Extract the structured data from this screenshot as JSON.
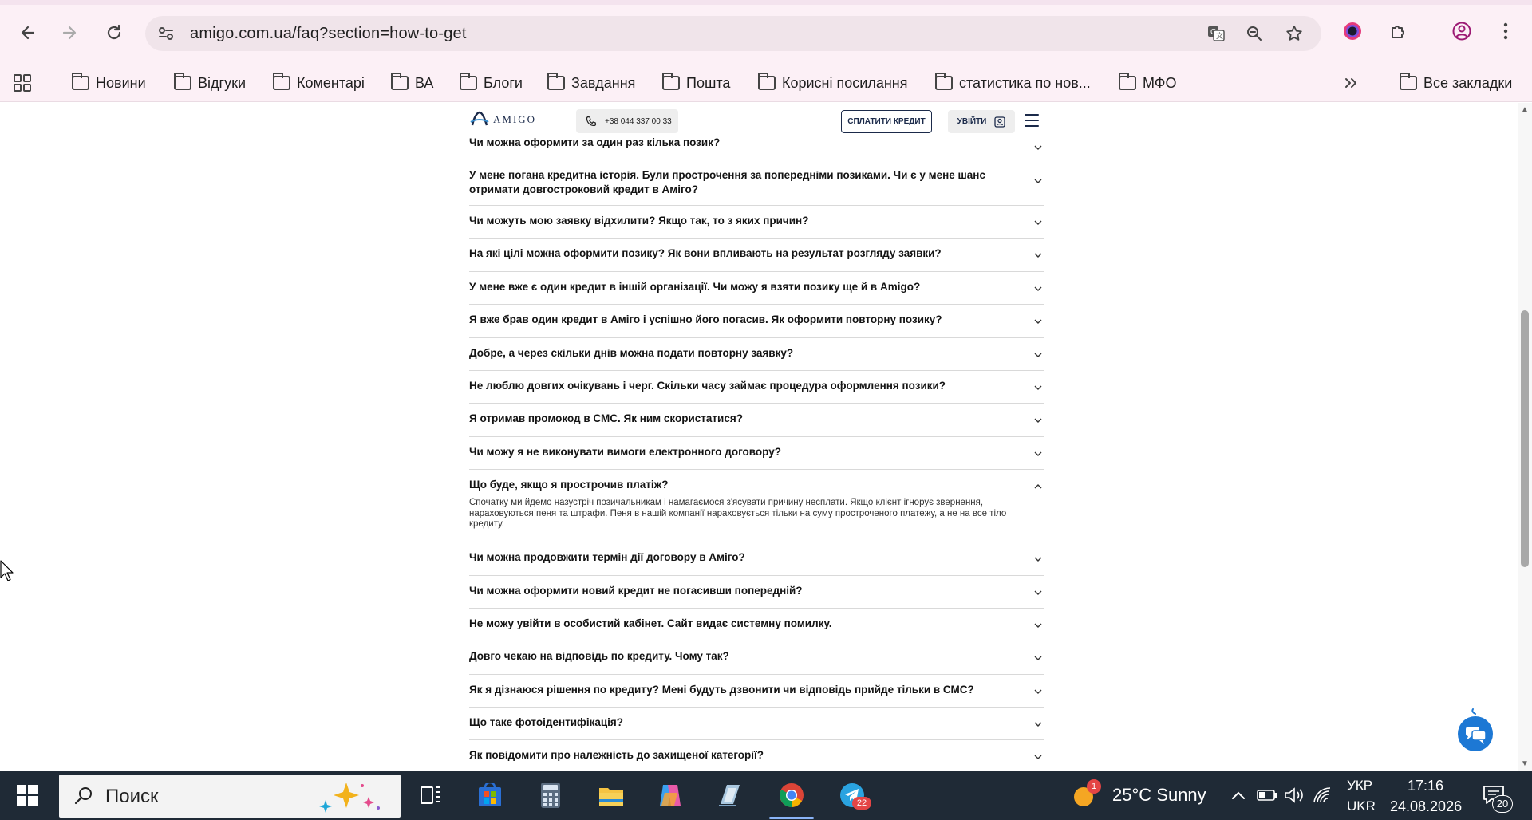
{
  "browser": {
    "url": "amigo.com.ua/faq?section=how-to-get",
    "bookmarks": [
      "Новини",
      "Відгуки",
      "Коментарі",
      "ВА",
      "Блоги",
      "Завдання",
      "Пошта",
      "Корисні посилання",
      "статистика по нов...",
      "МФО"
    ],
    "all_bookmarks": "Все закладки"
  },
  "site": {
    "logo": "AMIGO",
    "phone": "+38 044 337 00 33",
    "pay_button": "СПЛАТИТИ КРЕДИТ",
    "login_button": "УВІЙТИ"
  },
  "faq": {
    "items": [
      {
        "q": "Чи можна оформити за один раз кілька позик?"
      },
      {
        "q": "У мене погана кредитна історія. Були прострочення за попередніми позиками. Чи є у мене шанс отримати довгостроковий кредит в Аміго?"
      },
      {
        "q": "Чи можуть мою заявку відхилити? Якщо так, то з яких причин?"
      },
      {
        "q": "На які цілі можна оформити позику? Як вони впливають на результат розгляду заявки?"
      },
      {
        "q": "У мене вже є один кредит в іншій організації. Чи можу я взяти позику ще й в Amigo?"
      },
      {
        "q": "Я вже брав один кредит в Аміго і успішно його погасив. Як оформити повторну позику?"
      },
      {
        "q": "Добре, а через скільки днів можна подати повторну заявку?"
      },
      {
        "q": "Не люблю довгих очікувань і черг. Скільки часу займає процедура оформлення позики?"
      },
      {
        "q": "Я отримав промокод в СМС. Як ним скористатися?"
      },
      {
        "q": "Чи можу я не виконувати вимоги електронного договору?"
      },
      {
        "q": "Що буде, якщо я прострочив платіж?",
        "a": "Спочатку ми йдемо назустріч позичальникам і намагаємося з'ясувати причину несплати. Якщо клієнт ігнорує звернення, нараховуються пеня та штрафи. Пеня в нашій компанії нараховується тільки на суму простроченого платежу, а не на все тіло кредиту."
      },
      {
        "q": "Чи можна продовжити термін дії договору в Аміго?"
      },
      {
        "q": "Чи можна оформити новий кредит не погасивши попередній?"
      },
      {
        "q": "Не можу увійти в особистий кабінет. Сайт видає системну помилку."
      },
      {
        "q": "Довго чекаю на відповідь по кредиту. Чому так?"
      },
      {
        "q": "Як я дізнаюся рішення по кредиту? Мені будуть дзвонити чи відповідь прийде тільки в СМС?"
      },
      {
        "q": "Що таке фотоідентифікація?"
      },
      {
        "q": "Як повідомити про належність до захищеної категорії?"
      }
    ]
  },
  "taskbar": {
    "search_placeholder": "Поиск",
    "telegram_badge": "22",
    "weather_badge": "1",
    "weather": "25°C  Sunny",
    "lang_top": "УКР",
    "lang_bottom": "UKR",
    "time": "17:16",
    "date": "24.08.2026",
    "notifications": "20"
  }
}
